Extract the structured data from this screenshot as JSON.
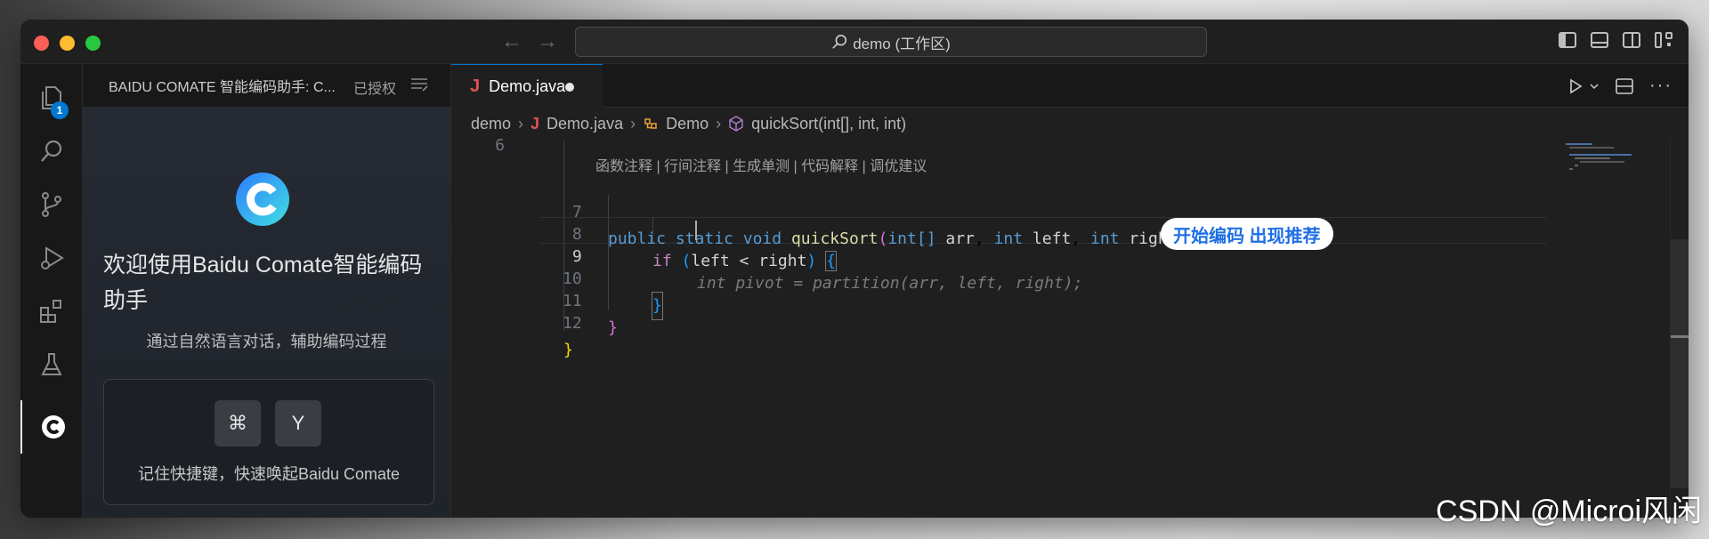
{
  "titlebar": {
    "search_label": "demo (工作区)"
  },
  "activity": {
    "explorer_badge": "1"
  },
  "sidebar": {
    "header_title": "BAIDU COMATE 智能编码助手: C...",
    "auth_status": "已授权",
    "welcome_title": "欢迎使用Baidu Comate智能编码助手",
    "subtitle": "通过自然语言对话，辅助编码过程",
    "keys": [
      "⌘",
      "Y"
    ],
    "shortcut_text": "记住快捷键，快速唤起Baidu Comate"
  },
  "editor": {
    "tab": {
      "icon": "J",
      "label": "Demo.java"
    },
    "breadcrumb": [
      "demo",
      "Demo.java",
      "Demo",
      "quickSort(int[], int, int)"
    ],
    "codelens": "函数注释 | 行间注释 | 生成单测 | 代码解释 | 调优建议",
    "line_numbers": [
      "6",
      "7",
      "8",
      "9",
      "10",
      "11",
      "12"
    ],
    "lines": {
      "l7_kw1": "public",
      "l7_kw2": "static",
      "l7_kw3": "void",
      "l7_fn": "quickSort",
      "l7_t1": "int[]",
      "l7_p1": "arr",
      "l7_t2": "int",
      "l7_p2": "left",
      "l7_t3": "int",
      "l7_p3": "right",
      "l8_kw": "if",
      "l8_cond": "left < right",
      "l9_ghost": "int pivot = partition(arr, left, right);"
    },
    "suggestion_pill": "开始编码 出现推荐"
  },
  "watermark": "CSDN @Microi风闲",
  "colors": {
    "accent": "#0078d4",
    "pill_text": "#1e6fe6",
    "tab_icon": "#e05252"
  }
}
